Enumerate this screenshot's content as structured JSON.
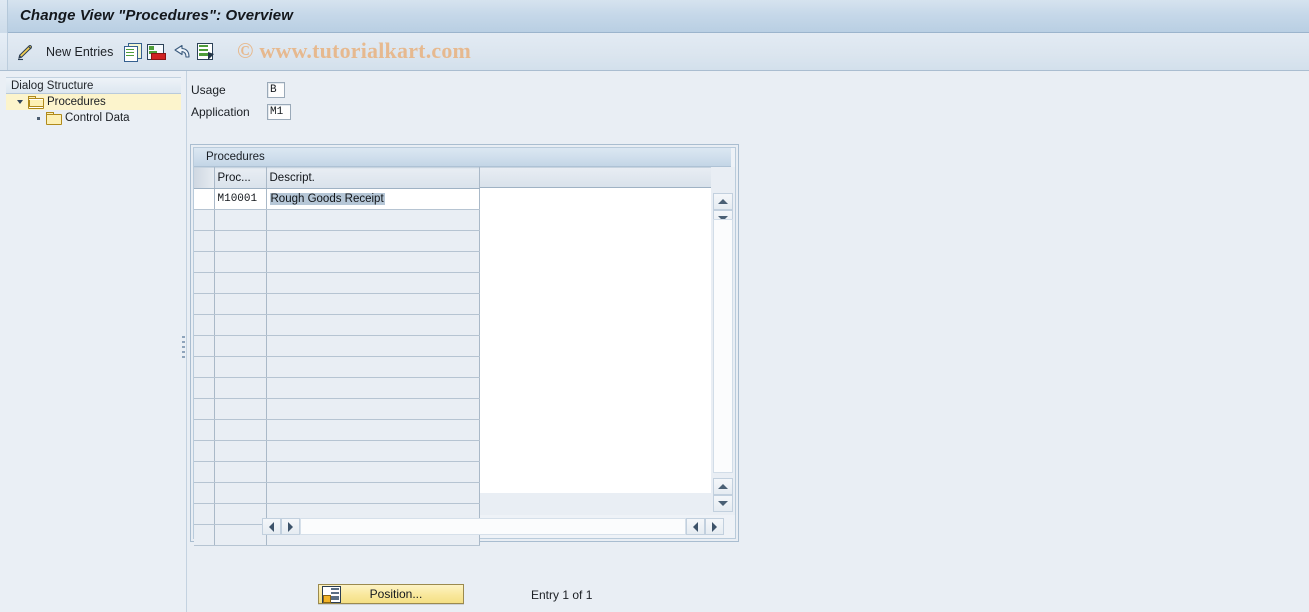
{
  "window": {
    "title": "Change View \"Procedures\": Overview"
  },
  "watermark": {
    "text": "© www.tutorialkart.com",
    "color": "#e9b07a"
  },
  "toolbar": {
    "items": [
      {
        "icon": "pencil-icon",
        "label": ""
      },
      {
        "icon": "",
        "label": "New Entries"
      },
      {
        "icon": "copy-icon",
        "label": ""
      },
      {
        "icon": "delete-row-icon",
        "label": ""
      },
      {
        "icon": "undo-icon",
        "label": ""
      },
      {
        "icon": "select-layout-icon",
        "label": ""
      }
    ],
    "new_entries_label": "New Entries"
  },
  "sidebar": {
    "header": "Dialog Structure",
    "items": [
      {
        "label": "Procedures",
        "selected": true,
        "expanded": true,
        "level": 0,
        "icon": "open-folder-icon"
      },
      {
        "label": "Control Data",
        "selected": false,
        "expanded": false,
        "level": 1,
        "icon": "folder-icon"
      }
    ]
  },
  "fields": [
    {
      "label": "Usage",
      "value": "B",
      "width": 18
    },
    {
      "label": "Application",
      "value": "M1",
      "width": 24
    }
  ],
  "table": {
    "panel_title": "Procedures",
    "columns": [
      "",
      "Proc...",
      "Descript."
    ],
    "rows": [
      {
        "proc": "M10001",
        "descript": "Rough Goods Receipt",
        "selected": true
      }
    ],
    "empty_row_count": 16,
    "column_config_icon": "column-settings-icon"
  },
  "scroll": {
    "up_icon": "scroll-up-icon",
    "down_icon": "scroll-down-icon",
    "left_icon": "scroll-left-icon",
    "right_icon": "scroll-right-icon"
  },
  "footer": {
    "position_button": "Position...",
    "position_icon": "position-icon",
    "entry_count": "Entry 1 of 1"
  },
  "colors": {
    "title_bar": "#c6d8e9",
    "toolbar": "#dbe5ef",
    "content_bg": "#e9eef4",
    "selected_tree": "#fcf4cc",
    "selection_highlight": "#b6c7d7",
    "button_yellow": "#f9e89c"
  }
}
